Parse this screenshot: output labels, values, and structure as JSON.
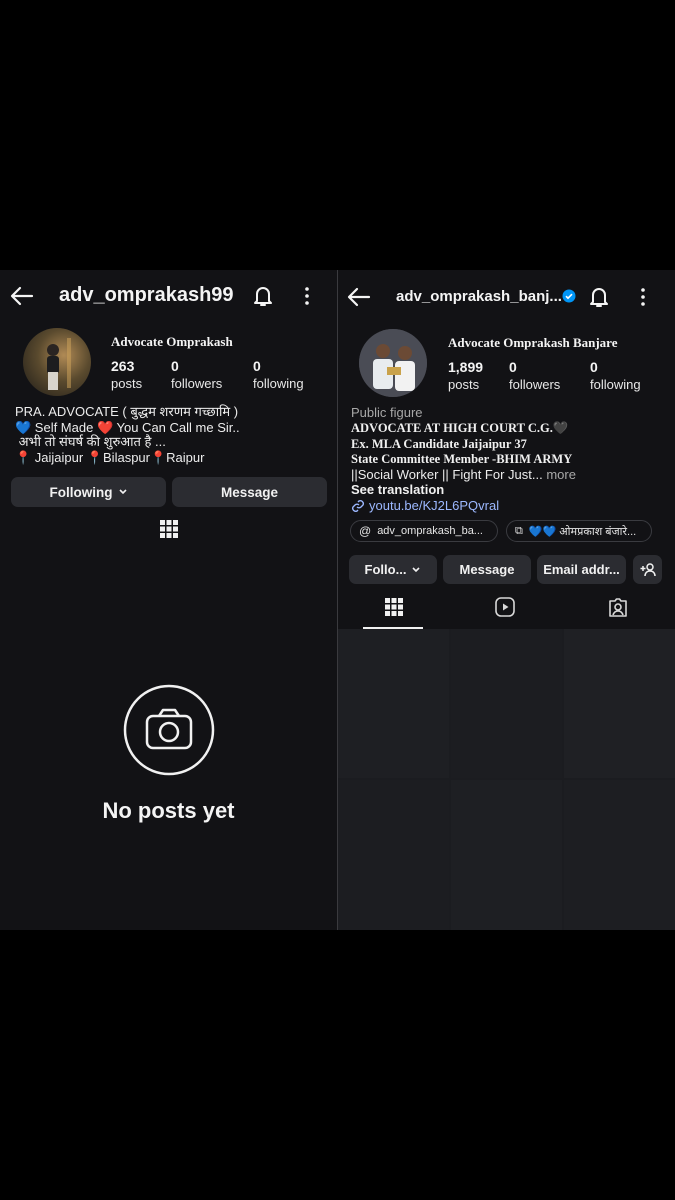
{
  "left": {
    "username": "adv_omprakash99",
    "display_name": "Advocate Omprakash",
    "stats": [
      {
        "value": "263",
        "label": "posts"
      },
      {
        "value": "0",
        "label": "followers"
      },
      {
        "value": "0",
        "label": "following"
      }
    ],
    "bio_lines": [
      "PRA. ADVOCATE ( बुद्धम शरणम गच्छामि )",
      "💙 Self Made ❤️ You Can Call me Sir..",
      " अभी तो संघर्ष की शुरुआत है ...",
      "📍 Jaijaipur 📍Bilaspur📍Raipur"
    ],
    "following_button": "Following",
    "message_button": "Message",
    "empty_text": "No posts yet"
  },
  "right": {
    "username": "adv_omprakash_banj...",
    "display_name": "Advocate Omprakash Banjare",
    "stats": [
      {
        "value": "1,899",
        "label": "posts"
      },
      {
        "value": "0",
        "label": "followers"
      },
      {
        "value": "0",
        "label": "following"
      }
    ],
    "category": "Public figure",
    "bio_lines": [
      "ADVOCATE AT HIGH COURT C.G.🖤",
      "Ex. MLA Candidate Jaijaipur 37",
      "State Committee Member -BHIM ARMY"
    ],
    "bio_last_line": "||Social Worker || Fight For Just...",
    "more": "more",
    "see_translation": "See translation",
    "link": "youtu.be/KJ2L6PQvral",
    "threads_chip": "adv_omprakash_ba...",
    "facebook_chip": "💙💙 ओमप्रकाश बंजारे...",
    "follow_button": "Follo...",
    "message_button": "Message",
    "email_button": "Email addr...",
    "colors": {
      "verified": "#0095f6",
      "link": "#9cb8ff",
      "muted": "#a8a8a8"
    }
  }
}
